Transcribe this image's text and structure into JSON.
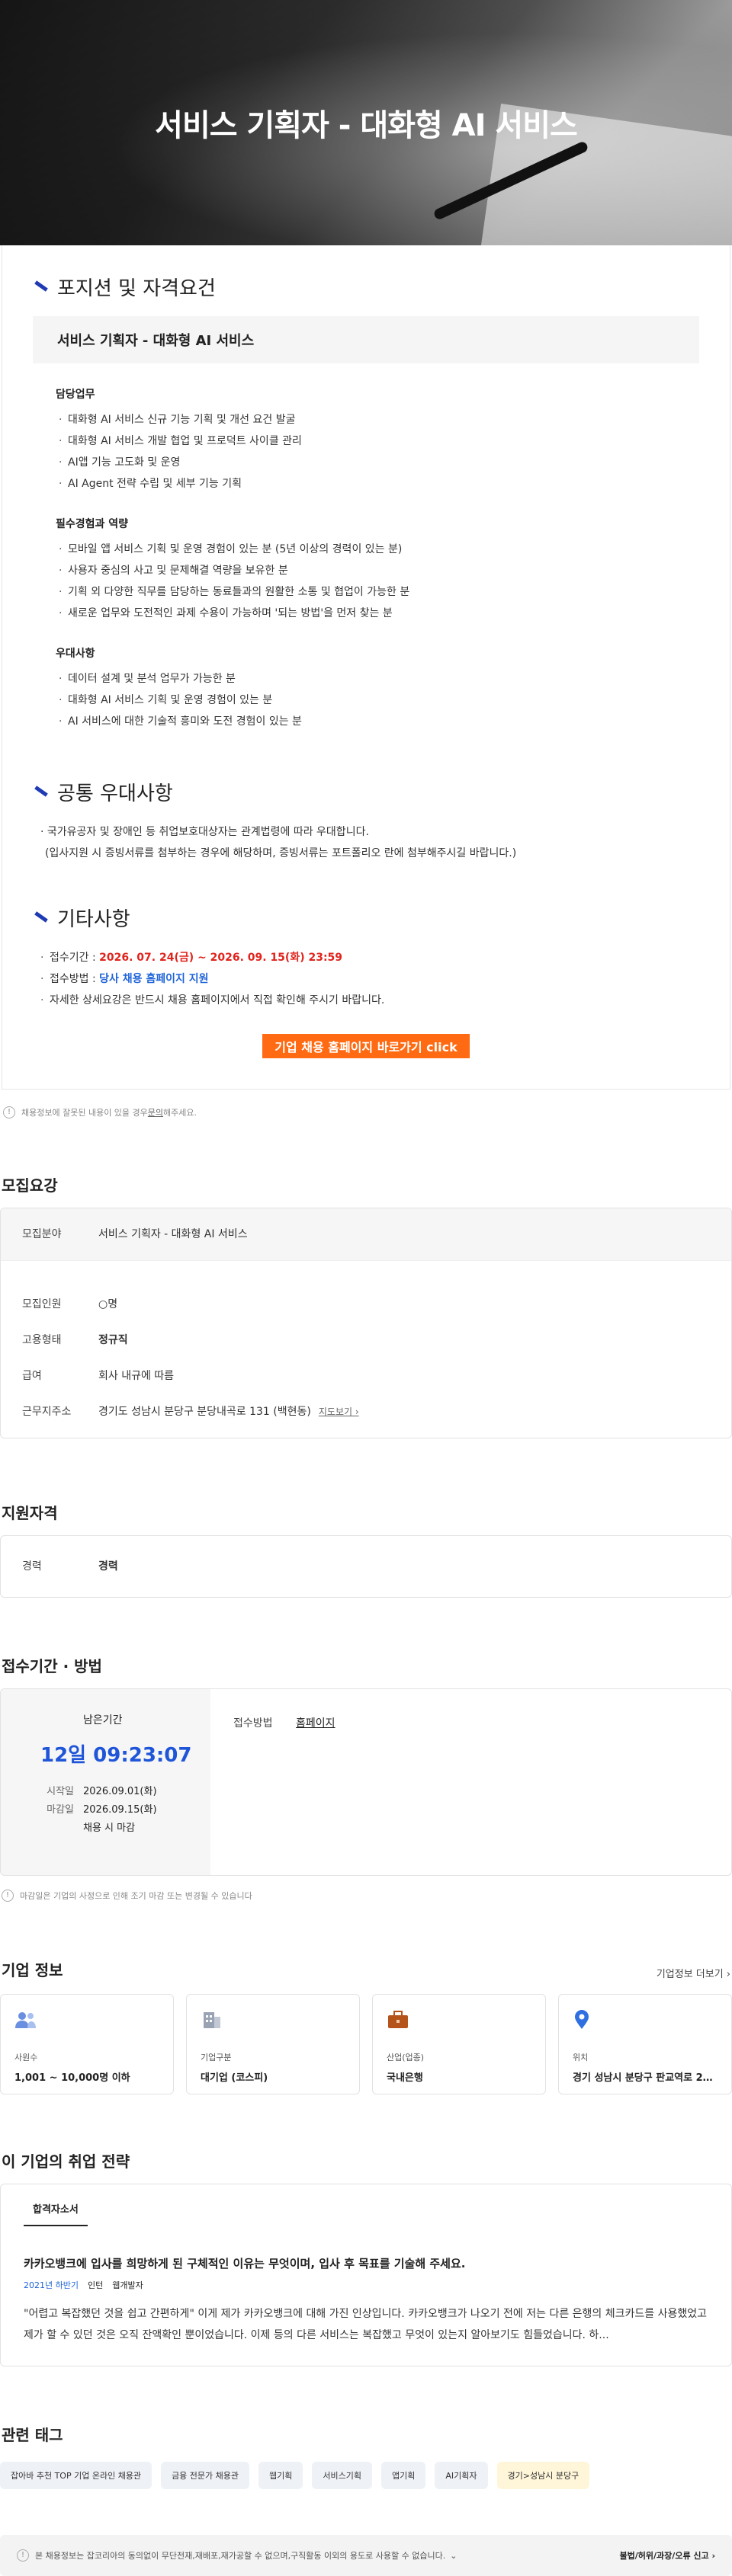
{
  "hero": {
    "title": "서비스 기획자 - 대화형 AI 서비스"
  },
  "jd": {
    "section1": "포지션 및 자격요건",
    "position_title": "서비스 기획자 - 대화형 AI 서비스",
    "duties": {
      "title": "담당업무",
      "items": [
        "대화형 AI 서비스 신규 기능 기획 및 개선 요건 발굴",
        "대화형 AI 서비스 개발 협업 및 프로덕트 사이클 관리",
        "AI앱 기능 고도화 및 운영",
        "AI Agent 전략 수립 및 세부 기능 기획"
      ]
    },
    "required": {
      "title": "필수경험과 역량",
      "items": [
        "모바일 앱 서비스 기획 및 운영 경험이 있는 분 (5년 이상의 경력이 있는 분)",
        "사용자 중심의 사고 및 문제해결 역량을 보유한 분",
        "기획 외 다양한 직무를 담당하는 동료들과의 원활한 소통 및 협업이 가능한 분",
        "새로운 업무와 도전적인 과제 수용이 가능하며 '되는 방법'을 먼저 찾는 분"
      ]
    },
    "preferred": {
      "title": "우대사항",
      "items": [
        "데이터 설계 및 분석 업무가 가능한 분",
        "대화형 AI 서비스 기획 및 운영 경험이 있는 분",
        "AI 서비스에 대한 기술적 흥미와 도전 경험이 있는 분"
      ]
    },
    "section2": "공통 우대사항",
    "common": [
      "· 국가유공자 및 장애인 등 취업보호대상자는 관계법령에 따라 우대합니다.",
      "(입사지원 시 증빙서류를 첨부하는 경우에 해당하며, 증빙서류는 포트폴리오 란에 첨부해주시길 바랍니다.)"
    ],
    "section3": "기타사항",
    "period_label": "접수기간 : ",
    "period_value": "2026. 07. 24(금) ~ 2026. 09. 15(화) 23:59",
    "method_label": "접수방법 : ",
    "method_value": "당사 채용 홈페이지 지원",
    "detail": "자세한 상세요강은 반드시 채용 홈페이지에서 직접 확인해 주시기 바랍니다.",
    "cta": "기업 채용 홈페이지 바로가기 click"
  },
  "report": {
    "pre": "채용정보에 잘못된 내용이 있을 경우 ",
    "link": "문의",
    "post": "해주세요."
  },
  "recruit": {
    "title": "모집요강",
    "field_k": "모집분야",
    "field_v": "서비스 기획자 - 대화형 AI 서비스",
    "count_k": "모집인원",
    "count_v": "○명",
    "type_k": "고용형태",
    "type_v": "정규직",
    "salary_k": "급여",
    "salary_v": "회사 내규에 따름",
    "loc_k": "근무지주소",
    "loc_v": "경기도 성남시 분당구 분당내곡로 131 (백현동)",
    "map": "지도보기 ›"
  },
  "qual": {
    "title": "지원자격",
    "k": "경력",
    "v": "경력"
  },
  "apply": {
    "title": "접수기간 · 방법",
    "remain_label": "남은기간",
    "remain_value": "12일 09:23:07",
    "start_k": "시작일",
    "start_v": "2026.09.01(화)",
    "end_k": "마감일",
    "end_v": "2026.09.15(화)",
    "end_note": "채용 시 마감",
    "method_k": "접수방법",
    "method_v": "홈페이지",
    "note": "마감일은 기업의 사정으로 인해 조기 마감 또는 변경될 수 있습니다"
  },
  "company": {
    "title": "기업 정보",
    "more": "기업정보 더보기 ›",
    "cards": [
      {
        "label": "사원수",
        "value": "1,001 ~ 10,000명 이하",
        "icon": "people-icon"
      },
      {
        "label": "기업구분",
        "value": "대기업 (코스피)",
        "icon": "building-icon"
      },
      {
        "label": "산업(업종)",
        "value": "국내은행",
        "icon": "briefcase-icon"
      },
      {
        "label": "위치",
        "value": "경기 성남시 분당구 판교역로 23...",
        "icon": "pin-icon"
      }
    ],
    "colors": {
      "people": "#6a8fe0",
      "building": "#9aa3b3",
      "briefcase": "#b5541a",
      "pin": "#2f6fe0"
    }
  },
  "strategy": {
    "title": "이 기업의 취업 전략",
    "tab": "합격자소서",
    "question": "카카오뱅크에 입사를 희망하게 된 구체적인 이유는 무엇이며, 입사 후 목표를 기술해 주세요.",
    "year": "2021년 하반기",
    "kind": "인턴",
    "role": "웹개발자",
    "answer": "\"어렵고 복잡했던 것을 쉽고 간편하게\" 이게 제가 카카오뱅크에 대해 가진 인상입니다. 카카오뱅크가 나오기 전에 저는 다른 은행의 체크카드를 사용했었고 제가 할 수 있던 것은 오직 잔액확인 뿐이었습니다. 이제 등의 다른 서비스는 복잡했고 무엇이 있는지 알아보기도 힘들었습니다. 하..."
  },
  "tags": {
    "title": "관련 태그",
    "items": [
      "잡아바 추천 TOP 기업 온라인 채용관",
      "금융 전문가 채용관",
      "웹기획",
      "서비스기획",
      "앱기획",
      "AI기획자",
      "경기>성남시 분당구"
    ]
  },
  "footer": {
    "left": "본 채용정보는 잡코리아의 동의없이 무단전재,재배포,재가공할 수 없으며,구직활동 이외의 용도로 사용할 수 없습니다.",
    "right": "불법/허위/과장/오류 신고 ›"
  }
}
